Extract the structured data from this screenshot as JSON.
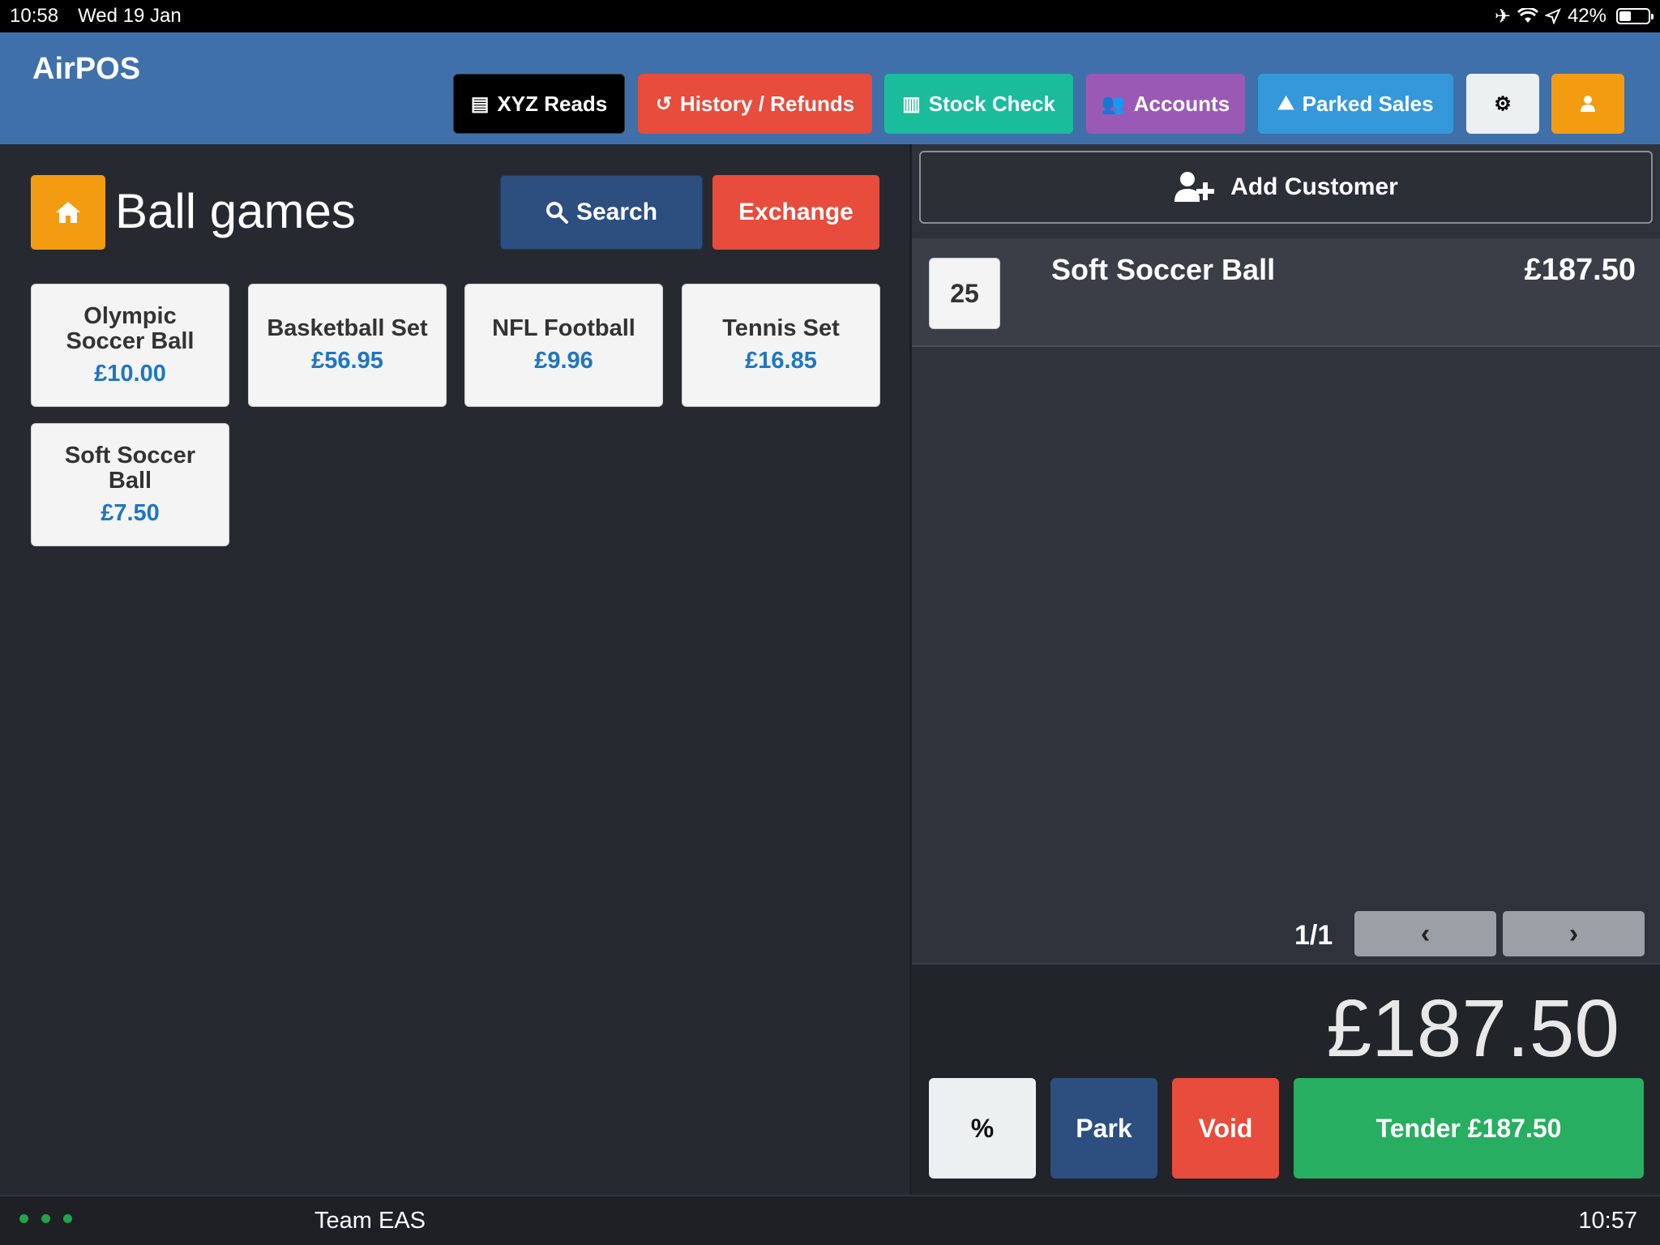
{
  "status_bar": {
    "time": "10:58",
    "date": "Wed 19 Jan",
    "battery": "42%",
    "battery_level": 0.42
  },
  "header": {
    "brand": "AirPOS",
    "nav": [
      {
        "label": "XYZ Reads",
        "icon": "list-icon",
        "color": "#000000"
      },
      {
        "label": "History / Refunds",
        "icon": "history-icon",
        "color": "#e74c3c"
      },
      {
        "label": "Stock Check",
        "icon": "barcode-icon",
        "color": "#1abc9c"
      },
      {
        "label": "Accounts",
        "icon": "users-icon",
        "color": "#9b59b6"
      },
      {
        "label": "Parked Sales",
        "icon": "road-icon",
        "color": "#3498db"
      }
    ],
    "settings_icon": "gear-icon",
    "user_icon": "user-icon"
  },
  "catalog": {
    "home_icon": "home-icon",
    "category": "Ball games",
    "search_label": "Search",
    "exchange_label": "Exchange",
    "products": [
      {
        "name": "Olympic Soccer Ball",
        "price": "£10.00"
      },
      {
        "name": "Basketball Set",
        "price": "£56.95"
      },
      {
        "name": "NFL Football",
        "price": "£9.96"
      },
      {
        "name": "Tennis Set",
        "price": "£16.85"
      },
      {
        "name": "Soft Soccer Ball",
        "price": "£7.50"
      }
    ]
  },
  "cart": {
    "add_customer": "Add Customer",
    "items": [
      {
        "qty": "25",
        "name": "Soft Soccer Ball",
        "price": "£187.50"
      }
    ],
    "page": "1/1",
    "total": "£187.50",
    "actions": {
      "discount": "%",
      "park": "Park",
      "void": "Void",
      "tender": "Tender £187.50"
    }
  },
  "footer": {
    "team": "Team EAS",
    "time": "10:57"
  },
  "colors": {
    "header": "#3f70aa",
    "accent_orange": "#f39c12",
    "price_blue": "#1f76c2",
    "tender_green": "#27ae60"
  }
}
